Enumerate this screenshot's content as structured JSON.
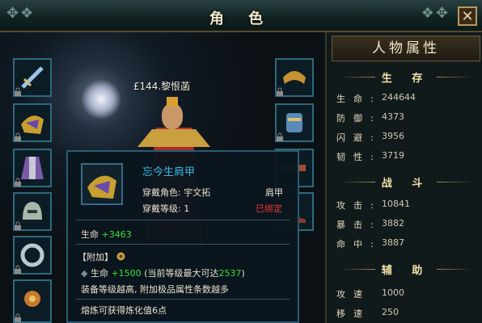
{
  "window": {
    "title": "角  色",
    "close_icon": "close-icon"
  },
  "character": {
    "name": "£144.黎恨菡"
  },
  "attributes_panel": {
    "header": "人物属性",
    "sections": [
      {
        "title": "生 存",
        "rows": [
          {
            "label": "生命:",
            "value": "244644"
          },
          {
            "label": "防御:",
            "value": "4373"
          },
          {
            "label": "闪避:",
            "value": "3956"
          },
          {
            "label": "韧性:",
            "value": "3719"
          }
        ]
      },
      {
        "title": "战 斗",
        "rows": [
          {
            "label": "攻击:",
            "value": "10841"
          },
          {
            "label": "暴击:",
            "value": "3882"
          },
          {
            "label": "命中:",
            "value": "3887"
          }
        ]
      },
      {
        "title": "辅 助",
        "rows": [
          {
            "label": "攻速",
            "value": "1000"
          },
          {
            "label": "移速",
            "value": "250"
          }
        ]
      }
    ]
  },
  "tooltip": {
    "item_name": "忘今生肩甲",
    "wearer_label": "穿戴角色: 宇文拓",
    "slot_type": "肩甲",
    "level_label": "穿戴等级: 1",
    "bound_status": "已绑定",
    "base_stat_label": "生命",
    "base_stat_value": "+3463",
    "addon_header": "【附加】",
    "addon_stat_label": "生命",
    "addon_stat_value": "+1500",
    "addon_note_prefix": "(当前等级最大可达",
    "addon_note_value": "2537",
    "addon_note_suffix": ")",
    "hint_1": "装备等级越高, 附加极品属性条数越多",
    "hint_2": "熔炼可获得炼化值6点"
  },
  "colors": {
    "accent_blue": "#3ab8e8",
    "bound_red": "#e83838",
    "stat_green": "#36e036",
    "gold": "#f2e2a8"
  }
}
